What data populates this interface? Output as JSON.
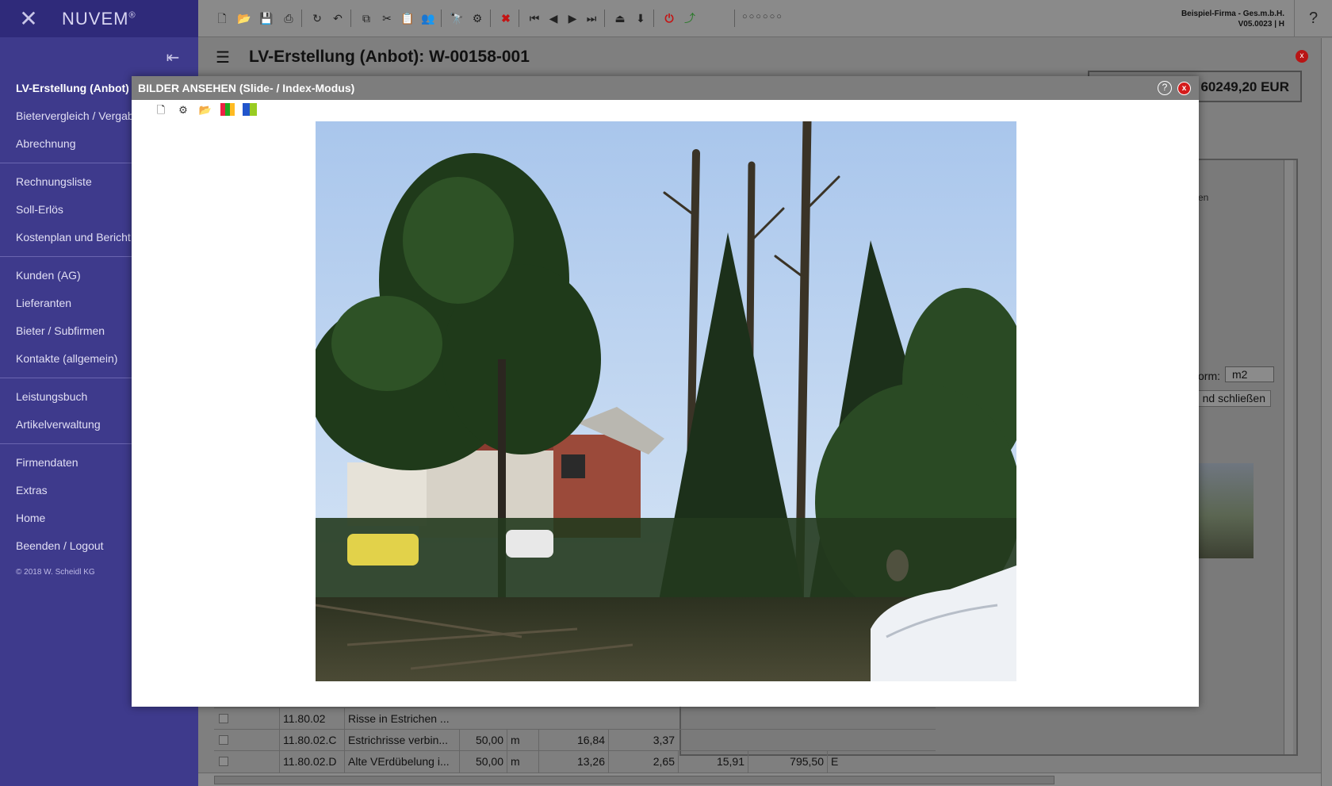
{
  "app": {
    "logo_text": "NUVEM",
    "logo_mark": "®",
    "company_line1": "Beispiel-Firma - Ges.m.b.H.",
    "company_line2": "V05.0023 | H",
    "help_label": "?"
  },
  "sidebar": {
    "items": [
      {
        "label": "LV-Erstellung (Anbot)",
        "active": true
      },
      {
        "label": "Bietervergleich / Vergabe"
      },
      {
        "label": "Abrechnung"
      },
      {
        "label": "Rechnungsliste"
      },
      {
        "label": "Soll-Erlös"
      },
      {
        "label": "Kostenplan und Bericht"
      },
      {
        "label": "Kunden (AG)"
      },
      {
        "label": "Lieferanten"
      },
      {
        "label": "Bieter / Subfirmen"
      },
      {
        "label": "Kontakte (allgemein)"
      },
      {
        "label": "Leistungsbuch"
      },
      {
        "label": "Artikelverwaltung"
      },
      {
        "label": "Firmendaten"
      },
      {
        "label": "Extras"
      },
      {
        "label": "Home"
      },
      {
        "label": "Beenden / Logout"
      }
    ],
    "copyright": "© 2018 W. Scheidl KG"
  },
  "page": {
    "title": "LV-Erstellung (Anbot): W-00158-001",
    "total": "60249,20 EUR",
    "close_label": "x"
  },
  "right_panel": {
    "fragment_text": "en",
    "form_label": "orm:",
    "unit_value": "m2",
    "close_button": "nd schließen"
  },
  "table": {
    "rows": [
      {
        "pos": "11.80.02",
        "text": "Risse in Estrichen ...",
        "qty": "",
        "unit": "",
        "price": "",
        "extra": ""
      },
      {
        "pos": "11.80.02.C",
        "text": "Estrichrisse verbin...",
        "qty": "50,00",
        "unit": "m",
        "price": "16,84",
        "extra": "3,37"
      },
      {
        "pos": "11.80.02.D",
        "text": "Alte VErdübelung i...",
        "qty": "50,00",
        "unit": "m",
        "price": "13,26",
        "extra": "2,65",
        "v1": "15,91",
        "v2": "795,50",
        "flag": "E"
      }
    ]
  },
  "modal": {
    "title": "BILDER ANSEHEN (Slide- / Index-Modus)",
    "help_label": "?",
    "close_label": "x",
    "photo_subject": "trees-and-houses-photo"
  }
}
